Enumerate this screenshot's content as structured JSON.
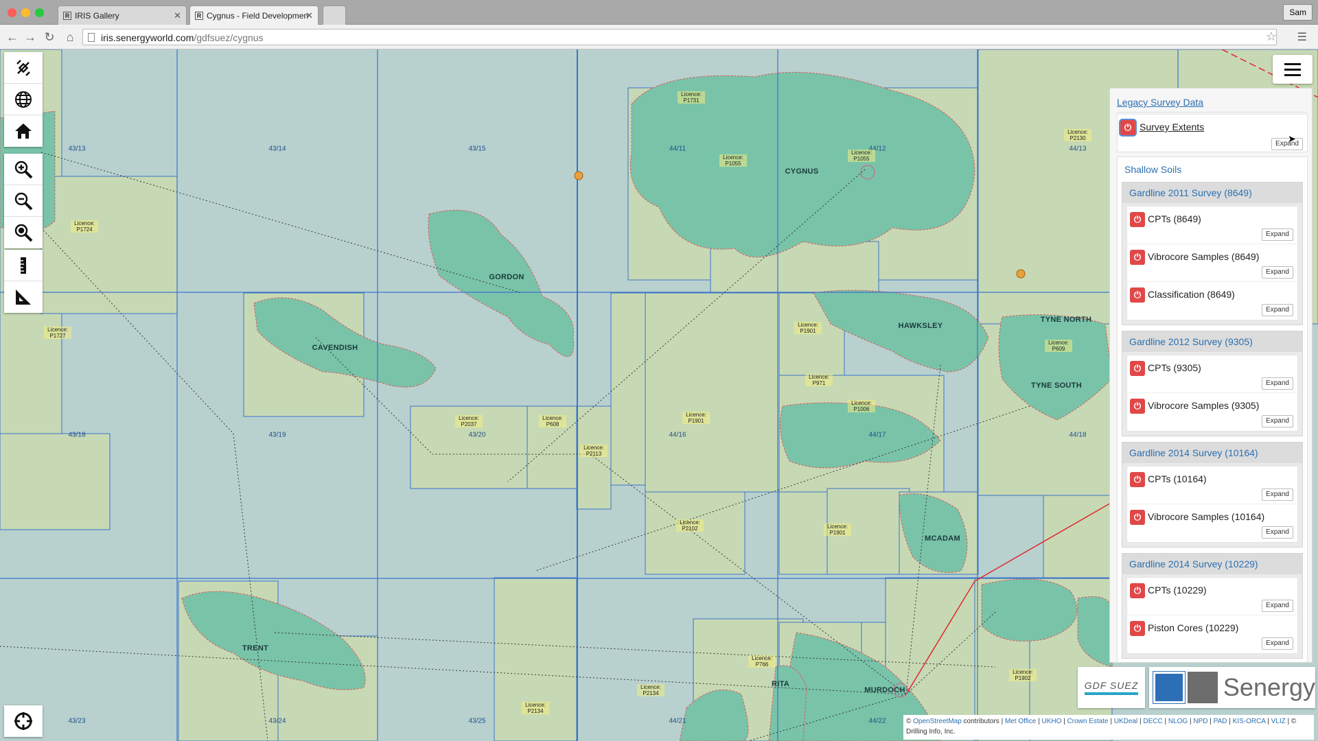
{
  "browser": {
    "tabs": [
      {
        "title": "IRIS Gallery",
        "active": false
      },
      {
        "title": "Cygnus - Field Developmen",
        "active": true
      }
    ],
    "user_button": "Sam",
    "url_host": "iris.senergyworld.com",
    "url_path": "/gdfsuez/cygnus"
  },
  "map": {
    "block_labels": [
      "43/13",
      "43/14",
      "43/15",
      "44/11",
      "44/12",
      "44/13",
      "43/18",
      "43/19",
      "43/20",
      "44/16",
      "44/17",
      "44/18",
      "43/23",
      "43/24",
      "43/25",
      "44/21",
      "44/22"
    ],
    "field_labels": [
      "CYGNUS",
      "GORDON",
      "CAVENDISH",
      "HAWKSLEY",
      "TYNE NORTH",
      "TYNE SOUTH",
      "MCADAM",
      "TRENT",
      "RITA",
      "MURDOCH"
    ],
    "licence_labels": [
      "Licence: P1731",
      "Licence: P1055",
      "Licence: P1055",
      "Licence: P2130",
      "Licence: P1724",
      "Licence: P1727",
      "Licence: P1901",
      "Licence: P2037",
      "Licence: P608",
      "Licence: P2113",
      "Licence: P1901",
      "Licence: P971",
      "Licence: P1006",
      "Licence: P609",
      "Licence: P2102",
      "Licence: P1901",
      "Licence: P2134",
      "Licence: P2134",
      "Licence: P1902",
      "Licence: P766"
    ]
  },
  "left_tools": {
    "group1": [
      "satellite-icon",
      "globe-icon",
      "home-icon"
    ],
    "group2": [
      "zoom-in-icon",
      "zoom-out-icon",
      "zoom-extent-icon"
    ],
    "group3": [
      "ruler-icon",
      "area-measure-icon"
    ],
    "locate": "crosshair-icon"
  },
  "panel": {
    "legacy_title": "Legacy Survey Data",
    "legacy_layer": "Survey Extents",
    "expand_label": "Expand",
    "shallow_title": "Shallow Soils",
    "surveys": [
      {
        "title": "Gardline 2011 Survey (8649)",
        "layers": [
          "CPTs (8649)",
          "Vibrocore Samples (8649)",
          "Classification (8649)"
        ]
      },
      {
        "title": "Gardline 2012 Survey (9305)",
        "layers": [
          "CPTs (9305)",
          "Vibrocore Samples (9305)"
        ]
      },
      {
        "title": "Gardline 2014 Survey (10164)",
        "layers": [
          "CPTs (10164)",
          "Vibrocore Samples (10164)"
        ]
      },
      {
        "title": "Gardline 2014 Survey (10229)",
        "layers": [
          "CPTs (10229)",
          "Piston Cores (10229)"
        ]
      }
    ]
  },
  "logos": {
    "gdf": "GDF SUEZ",
    "senergy": "Senergy"
  },
  "attribution": {
    "prefix": "©",
    "osm": "OpenStreetMap",
    "contributors": "contributors |",
    "sources": [
      "Met Office",
      "UKHO",
      "Crown Estate",
      "UKDeal",
      "DECC",
      "NLOG",
      "NPD",
      "PAD",
      "KIS-ORCA",
      "VLIZ"
    ],
    "suffix": "© Drilling Info, Inc."
  },
  "colors": {
    "sea": "#b8d1cf",
    "land_block": "#c7d9b4",
    "field": "#79c3a9",
    "grid": "#3b73c9",
    "power": "#e04848",
    "link": "#2a6fb0"
  }
}
